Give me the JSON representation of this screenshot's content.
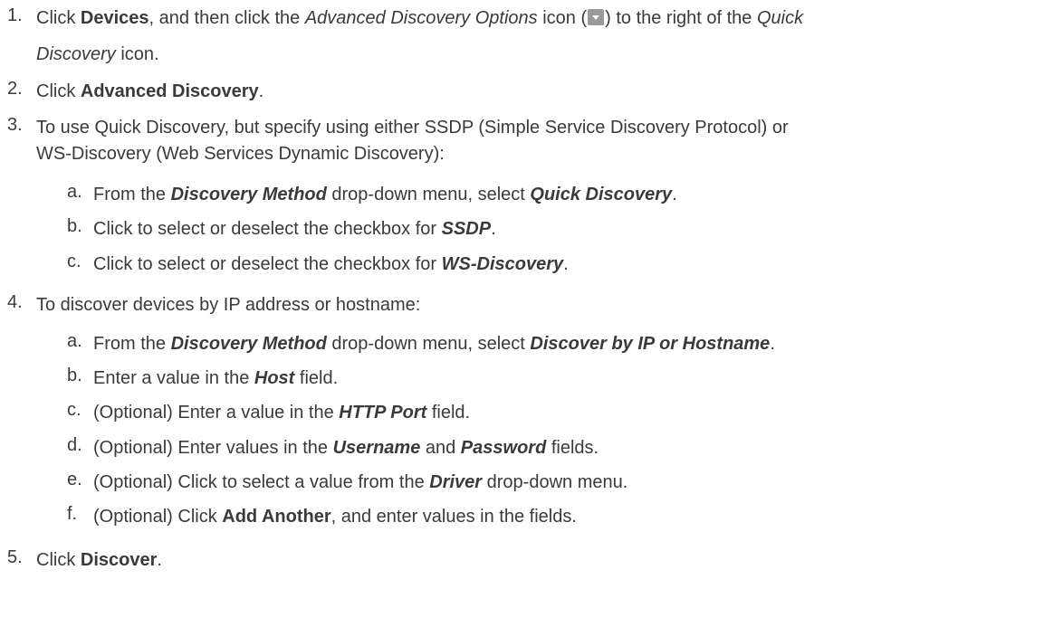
{
  "steps": {
    "s1": {
      "num": "1.",
      "t1": "Click ",
      "b1": "Devices",
      "t2": ", and then click the ",
      "i1": "Advanced Discovery Options",
      "t3": " icon (",
      "icon": "advanced-discovery-options-icon",
      "t4": ") to the right of the ",
      "i2": "Quick",
      "i3": "Discovery",
      "t5": " icon."
    },
    "s2": {
      "num": "2.",
      "t1": "Click ",
      "b1": "Advanced Discovery",
      "t2": "."
    },
    "s3": {
      "num": "3.",
      "line1": "To use Quick Discovery, but specify using either SSDP (Simple Service Discovery Protocol) or",
      "line2": "WS-Discovery (Web Services Dynamic Discovery):",
      "a": {
        "num": "a.",
        "t1": "From the ",
        "bi1": "Discovery Method",
        "t2": " drop-down menu, select ",
        "bi2": "Quick Discovery",
        "t3": "."
      },
      "b": {
        "num": "b.",
        "t1": "Click to select or deselect the checkbox for ",
        "bi1": "SSDP",
        "t2": "."
      },
      "c": {
        "num": "c.",
        "t1": "Click to select or deselect the checkbox for ",
        "bi1": "WS-Discovery",
        "t2": "."
      }
    },
    "s4": {
      "num": "4.",
      "line1": "To discover devices by IP address or hostname:",
      "a": {
        "num": "a.",
        "t1": "From the ",
        "bi1": "Discovery Method",
        "t2": " drop-down menu, select ",
        "bi2": "Discover by IP or Hostname",
        "t3": "."
      },
      "b": {
        "num": "b.",
        "t1": "Enter a value in the ",
        "bi1": "Host",
        "t2": " field."
      },
      "c": {
        "num": "c.",
        "t1": "(Optional) Enter a value in the ",
        "bi1": "HTTP Port",
        "t2": " field."
      },
      "d": {
        "num": "d.",
        "t1": "(Optional) Enter values in the ",
        "bi1": "Username",
        "t2": " and ",
        "bi2": "Password",
        "t3": " fields."
      },
      "e": {
        "num": "e.",
        "t1": "(Optional) Click to select a value from the ",
        "bi1": "Driver",
        "t2": " drop-down menu."
      },
      "f": {
        "num": "f.",
        "t1": "(Optional) Click ",
        "b1": "Add Another",
        "t2": ", and enter values in the fields."
      }
    },
    "s5": {
      "num": "5.",
      "t1": "Click ",
      "b1": "Discover",
      "t2": "."
    }
  }
}
